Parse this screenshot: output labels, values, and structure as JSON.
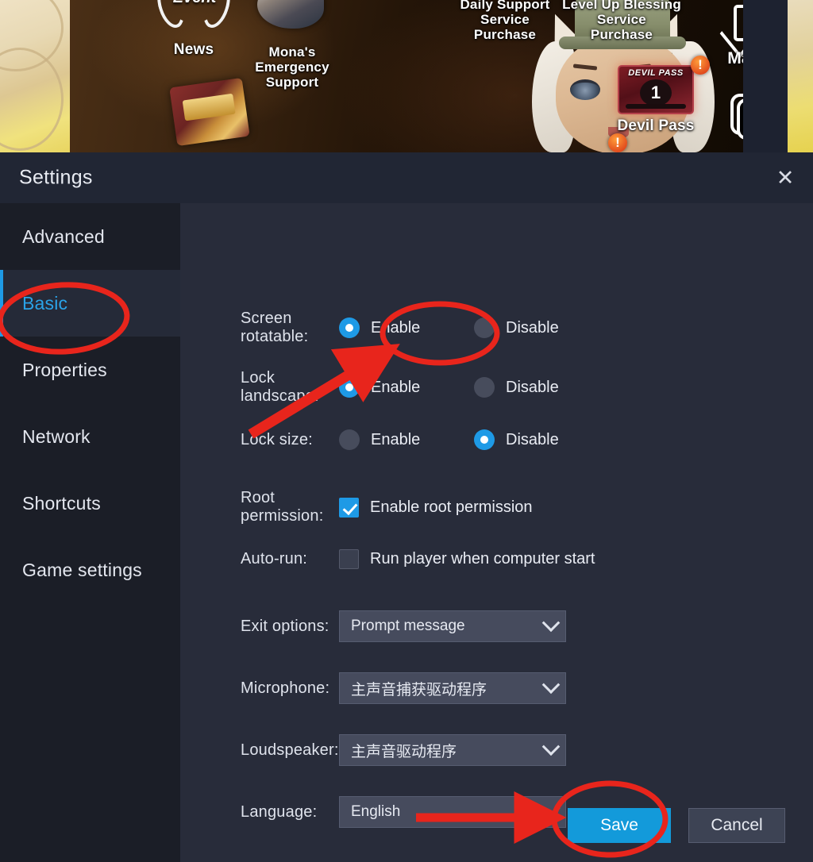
{
  "game_overlay": {
    "event_label": "Event",
    "items": [
      {
        "label": "News",
        "icon": "laurel-wreath-icon"
      },
      {
        "label": "Mona's\nEmergency\nSupport",
        "icon": "mona-portrait-icon"
      },
      {
        "label": "Daily Support\nService\nPurchase",
        "icon": "daily-support-icon"
      },
      {
        "label": "Level Up Blessing\nService\nPurchase",
        "icon": "level-up-blessing-icon"
      },
      {
        "label": "Devil Pass",
        "icon": "devil-pass-icon"
      },
      {
        "label": "Mailbox",
        "icon": "mail-envelope-icon"
      }
    ],
    "news_label": "News",
    "mona_label": "Mona's\nEmergency\nSupport",
    "daily_support_label": "Daily Support\nService\nPurchase",
    "level_up_label": "Level Up Blessing\nService\nPurchase",
    "devil_pass_label": "Devil Pass",
    "devil_pass_title": "DEVIL PASS",
    "devil_pass_level": "1",
    "mailbox_label": "Mailbox",
    "alert_badge": "!",
    "volume_up_sign": "+",
    "volume_down_sign": "−"
  },
  "window": {
    "title": "Settings",
    "close_icon": "✕"
  },
  "sidebar": {
    "items": [
      {
        "label": "Advanced",
        "active": false
      },
      {
        "label": "Basic",
        "active": true
      },
      {
        "label": "Properties",
        "active": false
      },
      {
        "label": "Network",
        "active": false
      },
      {
        "label": "Shortcuts",
        "active": false
      },
      {
        "label": "Game settings",
        "active": false
      }
    ]
  },
  "form": {
    "screen_rotatable": {
      "label": "Screen rotatable:",
      "enable_label": "Enable",
      "disable_label": "Disable",
      "value": "Enable"
    },
    "lock_landscape": {
      "label": "Lock landscape:",
      "enable_label": "Enable",
      "disable_label": "Disable",
      "value": "Enable"
    },
    "lock_size": {
      "label": "Lock size:",
      "enable_label": "Enable",
      "disable_label": "Disable",
      "value": "Disable"
    },
    "root_permission": {
      "label": "Root permission:",
      "checkbox_label": "Enable root permission",
      "checked": true
    },
    "auto_run": {
      "label": "Auto-run:",
      "checkbox_label": "Run player when computer start",
      "checked": false
    },
    "exit_options": {
      "label": "Exit options:",
      "value": "Prompt message"
    },
    "microphone": {
      "label": "Microphone:",
      "value": "主声音捕获驱动程序"
    },
    "loudspeaker": {
      "label": "Loudspeaker:",
      "value": "主声音驱动程序"
    },
    "language": {
      "label": "Language:",
      "value": "English"
    }
  },
  "footer": {
    "save_label": "Save",
    "cancel_label": "Cancel"
  },
  "annotations": {
    "accent_color": "#e8251c",
    "highlight_basic": "ellipse around Basic sidebar item",
    "highlight_lock_landscape": "ellipse around Lock landscape Enable radio",
    "highlight_save": "ellipse around Save button",
    "arrow_to_lock_landscape": "red arrow pointing to Lock landscape Enable",
    "arrow_to_save": "red arrow pointing to Save button"
  },
  "colors": {
    "accent_blue": "#1e9ae6",
    "window_bg": "#282c3a",
    "sidebar_bg": "#1b1e27",
    "titlebar_bg": "#212634",
    "dropdown_bg": "#464b5d",
    "annotation_red": "#e8251c"
  }
}
